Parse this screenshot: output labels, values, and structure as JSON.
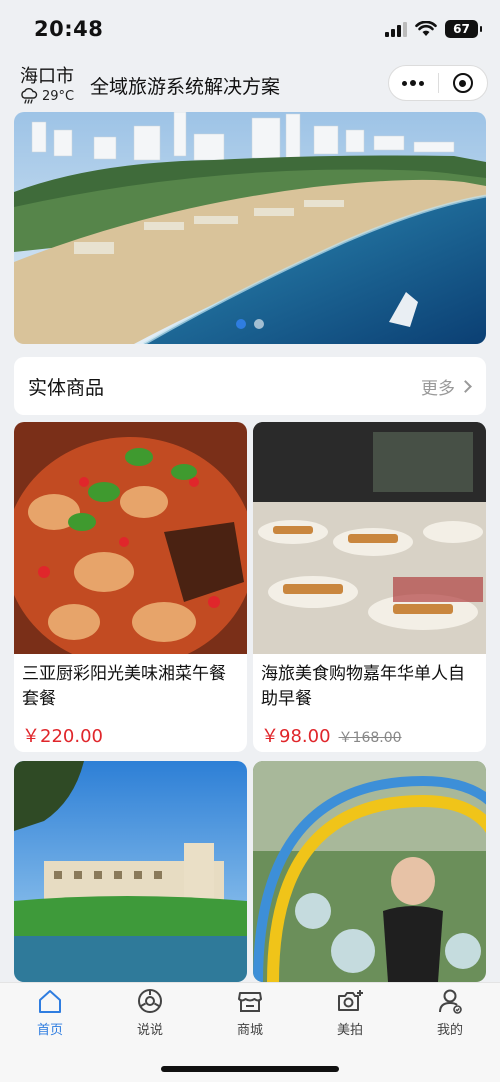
{
  "status": {
    "time": "20:48",
    "battery": "67"
  },
  "header": {
    "city": "海口市",
    "temperature": "29°C",
    "weather_icon": "rain-cloud-icon",
    "title": "全域旅游系统解决方案"
  },
  "banner": {
    "slide_count": 2,
    "active_index": 0
  },
  "section": {
    "title": "实体商品",
    "more_label": "更多"
  },
  "products": [
    {
      "name": "三亚厨彩阳光美味湘菜午餐套餐",
      "price": "￥220.00",
      "original_price": ""
    },
    {
      "name": "海旅美食购物嘉年华单人自助早餐",
      "price": "￥98.00",
      "original_price": "￥168.00"
    },
    {
      "name": "",
      "price": "",
      "original_price": ""
    },
    {
      "name": "",
      "price": "",
      "original_price": ""
    }
  ],
  "tabbar": {
    "active": "home",
    "items": [
      {
        "label": "首页",
        "icon": "home-icon"
      },
      {
        "label": "说说",
        "icon": "chat-icon"
      },
      {
        "label": "商城",
        "icon": "store-icon"
      },
      {
        "label": "美拍",
        "icon": "camera-icon"
      },
      {
        "label": "我的",
        "icon": "profile-icon"
      }
    ]
  },
  "colors": {
    "accent": "#2f7de0",
    "price": "#e0262b",
    "background": "#eef0f3"
  }
}
